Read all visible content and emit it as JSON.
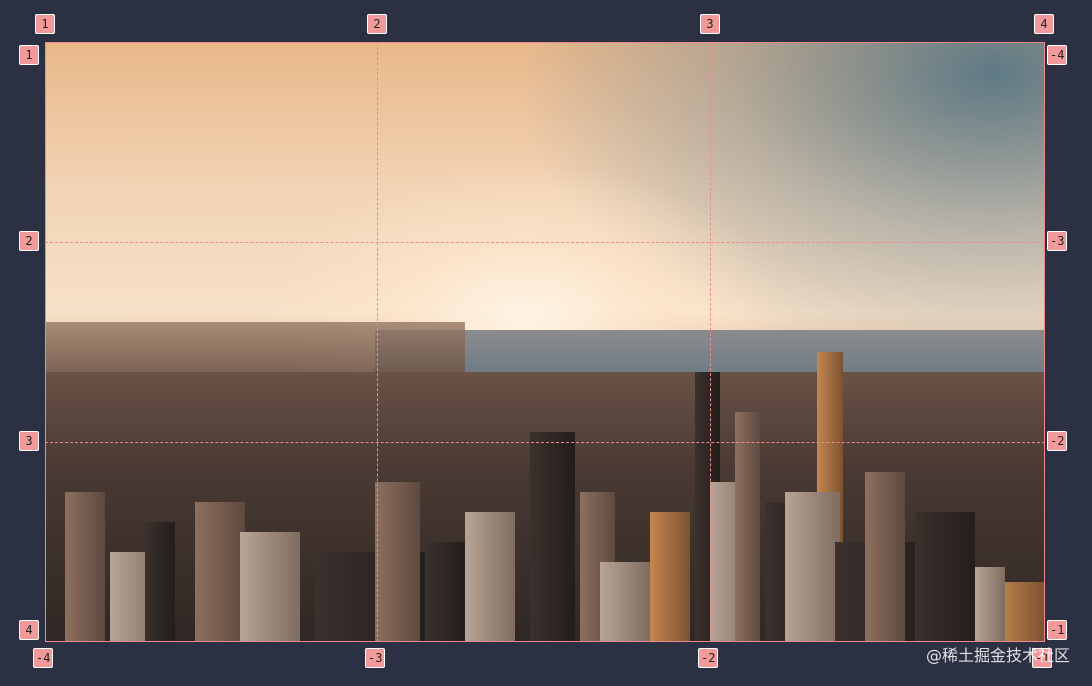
{
  "markers": {
    "top": [
      "1",
      "2",
      "3",
      "4"
    ],
    "bottom": [
      "-4",
      "-3",
      "-2",
      "-1"
    ],
    "left": [
      "1",
      "2",
      "3",
      "4"
    ],
    "right": [
      "-4",
      "-3",
      "-2",
      "-1"
    ]
  },
  "watermark": "@稀土掘金技术社区",
  "colors": {
    "grid_line": "#f08a8a",
    "marker_bg": "#f29a9a",
    "background": "#2b3142"
  }
}
